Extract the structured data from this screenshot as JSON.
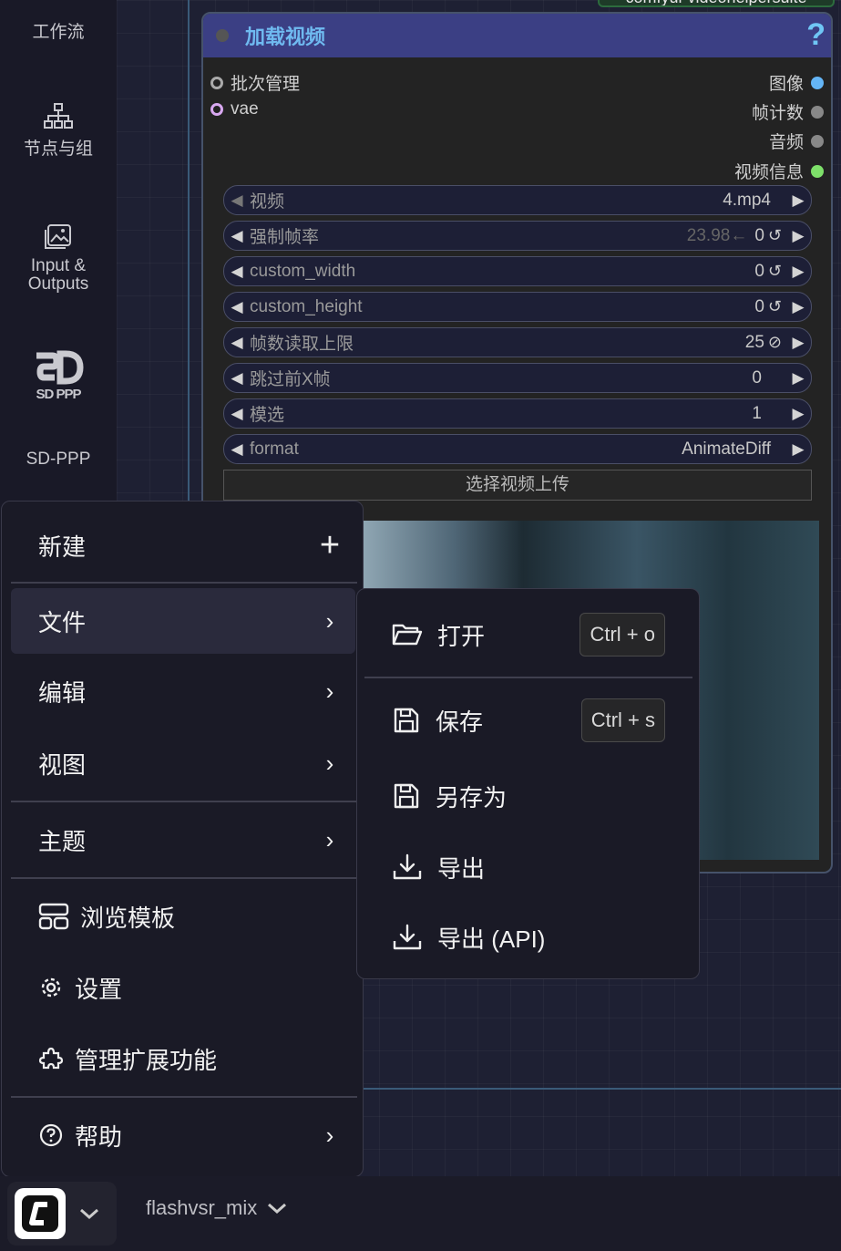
{
  "sidebar": {
    "workflow_label": "工作流",
    "nodes_label": "节点与组",
    "io_label": "Input &\nOutputs",
    "sdppp_logo_text": "SD PPP",
    "sdppp_label": "SD-PPP"
  },
  "node": {
    "top_badge": "comfyui-videohelpersuite",
    "title": "加载视频",
    "help": "?",
    "inputs": [
      {
        "label": "批次管理"
      },
      {
        "label": "vae"
      }
    ],
    "outputs": [
      {
        "label": "图像",
        "color": "#64b5f6"
      },
      {
        "label": "帧计数",
        "color": "#888888"
      },
      {
        "label": "音频",
        "color": "#888888"
      },
      {
        "label": "视频信息",
        "color": "#7ee06a"
      }
    ],
    "widgets": [
      {
        "name": "视频",
        "value": "4.mp4"
      },
      {
        "name": "强制帧率",
        "faded": "23.98←",
        "value": "0"
      },
      {
        "name": "custom_width",
        "value": "0"
      },
      {
        "name": "custom_height",
        "value": "0"
      },
      {
        "name": "帧数读取上限",
        "value": "25"
      },
      {
        "name": "跳过前X帧",
        "value": "0"
      },
      {
        "name": "模选",
        "value": "1"
      },
      {
        "name": "format",
        "value": "AnimateDiff"
      }
    ],
    "upload_button": "选择视频上传"
  },
  "main_menu": {
    "new": "新建",
    "file": "文件",
    "edit": "编辑",
    "view": "视图",
    "theme": "主题",
    "browse_templates": "浏览模板",
    "settings": "设置",
    "manage_extensions": "管理扩展功能",
    "help": "帮助"
  },
  "file_menu": {
    "open": "打开",
    "open_shortcut": "Ctrl + o",
    "save": "保存",
    "save_shortcut": "Ctrl + s",
    "save_as": "另存为",
    "export": "导出",
    "export_api": "导出 (API)"
  },
  "bottombar": {
    "workflow_name": "flashvsr_mix"
  }
}
